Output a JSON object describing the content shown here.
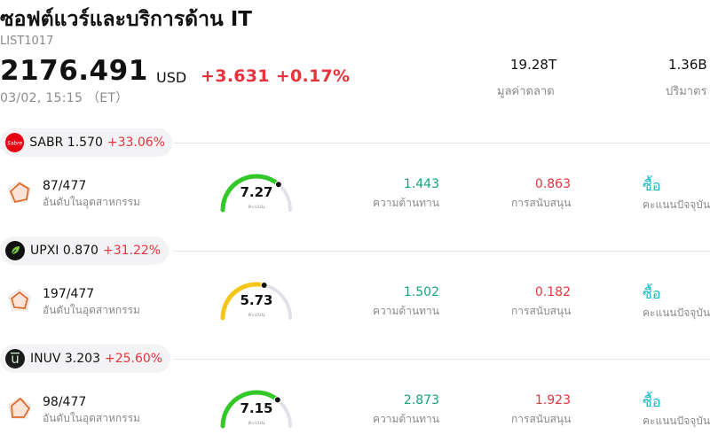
{
  "header": {
    "title": "ซอฟต์แวร์และบริการด้าน IT",
    "code": "LIST1017",
    "price": "2176.491",
    "currency": "USD",
    "change": "+3.631 +0.17%",
    "time": "03/02, 15:15 （ET）"
  },
  "stats": [
    {
      "value": "19.28T",
      "label": "มูลค่าตลาด"
    },
    {
      "value": "1.36B",
      "label": "ปริมาตร"
    }
  ],
  "labels": {
    "rank": "อันดับในอุตสาหกรรม",
    "resistance": "ความต้านทาน",
    "support": "การสนับสนุน",
    "score": "คะแนนปัจจุบัน",
    "gauge": "คะแนน"
  },
  "colors": {
    "up": "#e8323c",
    "resistance": "#14a37f",
    "gauge_green": "#32c828",
    "gauge_yellow": "#f5c518",
    "buy": "#13b8c9"
  },
  "stocks": [
    {
      "symbol": "SABR",
      "price": "1.570",
      "change": "+33.06%",
      "logo": "sabre-logo",
      "rank": "87/477",
      "score": "7.27",
      "score_fraction": 0.727,
      "resistance": "1.443",
      "support": "0.863",
      "signal": "ซื้อ"
    },
    {
      "symbol": "UPXI",
      "price": "0.870",
      "change": "+31.22%",
      "logo": "upexi-leaf-logo",
      "rank": "197/477",
      "score": "5.73",
      "score_fraction": 0.573,
      "resistance": "1.502",
      "support": "0.182",
      "signal": "ซื้อ"
    },
    {
      "symbol": "INUV",
      "price": "3.203",
      "change": "+25.60%",
      "logo": "inuvo-logo",
      "rank": "98/477",
      "score": "7.15",
      "score_fraction": 0.715,
      "resistance": "2.873",
      "support": "1.923",
      "signal": "ซื้อ"
    }
  ]
}
